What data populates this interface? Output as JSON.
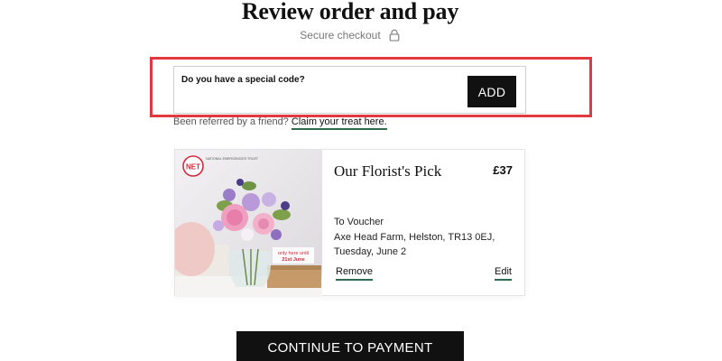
{
  "header": {
    "title": "Review order and pay",
    "secure_label": "Secure checkout",
    "secure_icon": "lock-icon"
  },
  "promo": {
    "label": "Do you have a special code?",
    "add_label": "ADD",
    "highlight_color": "#e0393e"
  },
  "referral": {
    "text": "Been referred by a friend?",
    "link_label": "Claim your treat here."
  },
  "product": {
    "name": "Our Florist's Pick",
    "price": "£37",
    "badge": "NET",
    "badge_text": "NATIONAL EMERGENCIES TRUST",
    "promo_sticker_line1": "only here until",
    "promo_sticker_line2": "21st June",
    "recipient": "To  Voucher",
    "address": "Axe Head Farm,   Helston,   TR13 0EJ,",
    "date": "Tuesday, June 2",
    "remove_label": "Remove",
    "edit_label": "Edit"
  },
  "actions": {
    "continue_label": "CONTINUE TO PAYMENT"
  },
  "colors": {
    "accent_underline": "#2f6b4f",
    "button_bg": "#111111"
  }
}
